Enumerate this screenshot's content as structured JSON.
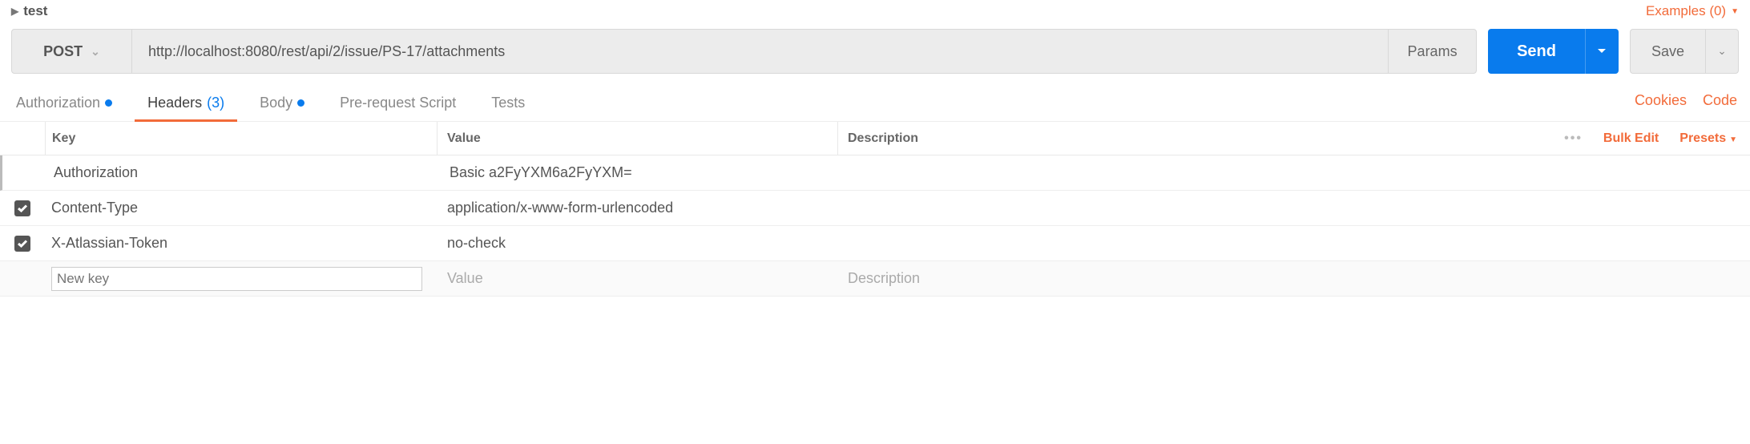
{
  "breadcrumb": {
    "name": "test"
  },
  "examples": {
    "label": "Examples (0)"
  },
  "request": {
    "method": "POST",
    "url": "http://localhost:8080/rest/api/2/issue/PS-17/attachments",
    "params_label": "Params",
    "send_label": "Send",
    "save_label": "Save"
  },
  "tabs": {
    "authorization": "Authorization",
    "headers": "Headers",
    "headers_count": "(3)",
    "body": "Body",
    "prerequest": "Pre-request Script",
    "tests": "Tests",
    "cookies": "Cookies",
    "code": "Code"
  },
  "table": {
    "headers": {
      "key": "Key",
      "value": "Value",
      "description": "Description"
    },
    "actions": {
      "bulk_edit": "Bulk Edit",
      "presets": "Presets"
    },
    "rows": [
      {
        "checked": null,
        "key": "Authorization",
        "value": "Basic a2FyYXM6a2FyYXM=",
        "description": ""
      },
      {
        "checked": true,
        "key": "Content-Type",
        "value": "application/x-www-form-urlencoded",
        "description": ""
      },
      {
        "checked": true,
        "key": "X-Atlassian-Token",
        "value": "no-check",
        "description": ""
      }
    ],
    "new_row": {
      "key_placeholder": "New key",
      "value_placeholder": "Value",
      "description_placeholder": "Description"
    }
  }
}
